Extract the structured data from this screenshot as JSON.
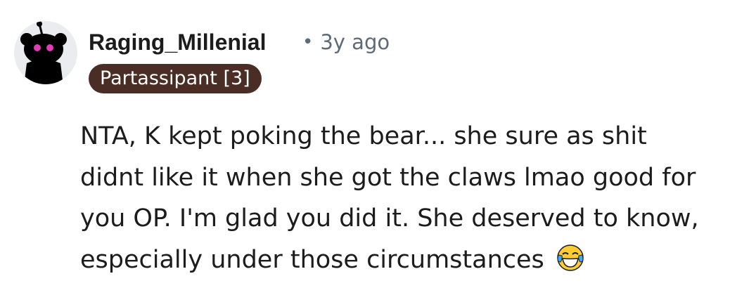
{
  "comment": {
    "author": "Raging_Millenial",
    "separator": "•",
    "timestamp": "3y ago",
    "flair": "Partassipant [3]",
    "text": "NTA, K kept poking the bear... she sure as shit didnt like it when she got the claws lmao good for you OP. I'm glad you did it. She deserved to know, especially under those circumstances",
    "emoji": "face-with-tears-of-joy-icon"
  },
  "colors": {
    "flair_background": "#4a2e26",
    "flair_text": "#ffffff",
    "meta_text": "#5c6b77",
    "body_text": "#1c1c1c",
    "avatar_background": "#eaecef"
  }
}
